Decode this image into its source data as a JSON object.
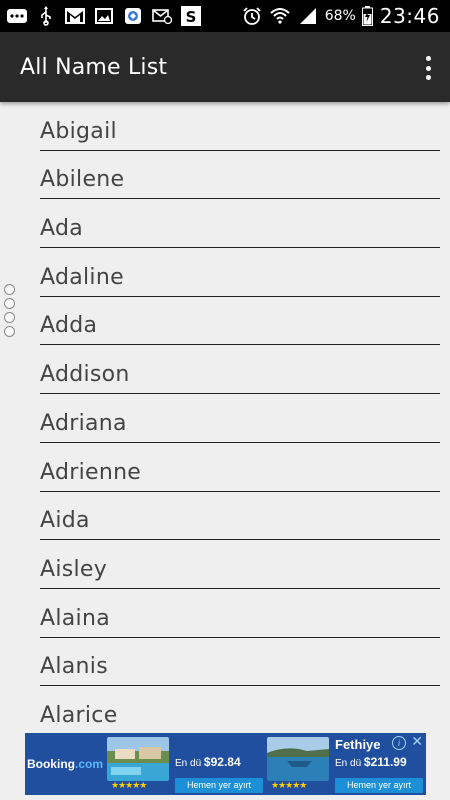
{
  "status_bar": {
    "battery_percent": "68%",
    "time": "23:46",
    "icons": [
      "more-icon",
      "usb-icon",
      "gmail-icon",
      "image-icon",
      "app-icon",
      "mail-icon",
      "s-app-icon",
      "alarm-icon",
      "wifi-icon",
      "signal-icon",
      "battery-icon"
    ]
  },
  "app_bar": {
    "title": "All Name List",
    "menu_icon": "overflow-menu-icon"
  },
  "names": [
    "Abigail",
    "Abilene",
    "Ada",
    "Adaline",
    "Adda",
    "Addison",
    "Adriana",
    "Adrienne",
    "Aida",
    "Aisley",
    "Alaina",
    "Alanis",
    "Alarice"
  ],
  "ad": {
    "brand_main": "Booking",
    "brand_suffix": ".com",
    "offers": [
      {
        "headline": "",
        "price_prefix": "En dü",
        "price": "$92.84",
        "cta": "Hemen yer ayırt",
        "stars": "★★★★★"
      },
      {
        "headline": "Fethiye",
        "price_prefix": "En dü",
        "price": "$211.99",
        "cta": "Hemen yer ayırt",
        "stars": "★★★★★"
      }
    ],
    "info_label": "i",
    "close_label": "✕"
  },
  "colors": {
    "app_bar": "#2a2a2a",
    "background": "#efefef",
    "ad_background": "#1f4f9e"
  }
}
